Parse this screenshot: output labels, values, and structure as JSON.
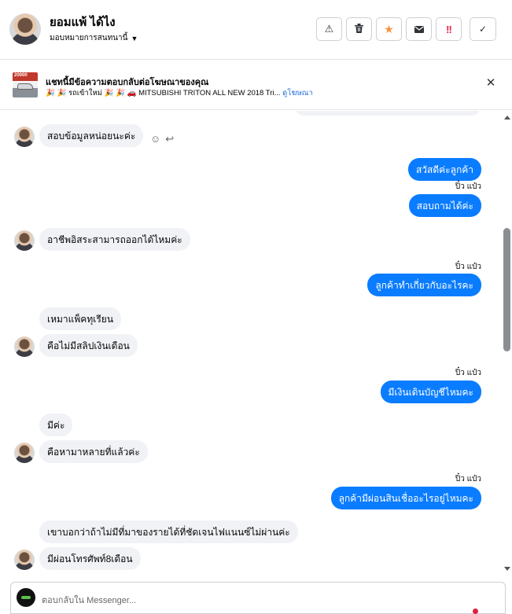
{
  "header": {
    "contact_name": "ยอมแพ้ ได้ไง",
    "assign_label": "มอบหมายการสนทนานี้",
    "actions": [
      {
        "icon": "warning-icon",
        "glyph": "⚠"
      },
      {
        "icon": "trash-icon",
        "glyph": "🗑"
      },
      {
        "icon": "star-icon",
        "glyph": "★"
      },
      {
        "icon": "mail-icon",
        "glyph": "✉"
      },
      {
        "icon": "exclamation-icon",
        "glyph": "!!"
      },
      {
        "icon": "check-icon",
        "glyph": "✓"
      }
    ]
  },
  "banner": {
    "title": "แชทนี้มีข้อความตอบกลับต่อโฆษณาของคุณ",
    "subtitle": "🎉 🎉 รถเข้าใหม่ 🎉 🎉 🚗 MITSUBISHI TRITON ALL NEW 2018 Tri... ",
    "link": "ดูโฆษณา",
    "thumb_tag": "20000"
  },
  "messages": [
    {
      "side": "in",
      "text": "สอบข้อมูลหน่อยนะค่ะ"
    },
    {
      "side": "out",
      "text": "สวัสดีค่ะลูกค้า"
    },
    {
      "side": "out",
      "text": "สอบถามได้ค่ะ"
    },
    {
      "side": "in",
      "text": "อาชีพอิสระสามารถออกได้ไหมค่ะ"
    },
    {
      "side": "out",
      "text": "ลูกค้าทำเกี่ยวกับอะไรคะ"
    },
    {
      "side": "in",
      "text": "เหมาแพ็คทุเรียน"
    },
    {
      "side": "in",
      "text": "คือไม่มีสลิปเงินเดือน"
    },
    {
      "side": "out",
      "text": "มีเงินเดินบัญชีไหมคะ"
    },
    {
      "side": "in",
      "text": "มีค่ะ"
    },
    {
      "side": "in",
      "text": "คือหามาหลายที่แล้วค่ะ"
    },
    {
      "side": "out",
      "text": "ลูกค้ามีผ่อนสินเชื่ออะไรอยู่ไหมคะ"
    },
    {
      "side": "in",
      "text": "เขาบอกว่าถ้าไม่มีที่มาของรายได้ที่ชัดเจนไฟแนนซ์ไม่ผ่านค่ะ"
    },
    {
      "side": "in",
      "text": "มีผ่อนโทรศัพท์8เดือน"
    }
  ],
  "sender_label": "ปิ๋ว แป๋ว",
  "composer": {
    "placeholder": "ตอบกลับใน Messenger..."
  }
}
